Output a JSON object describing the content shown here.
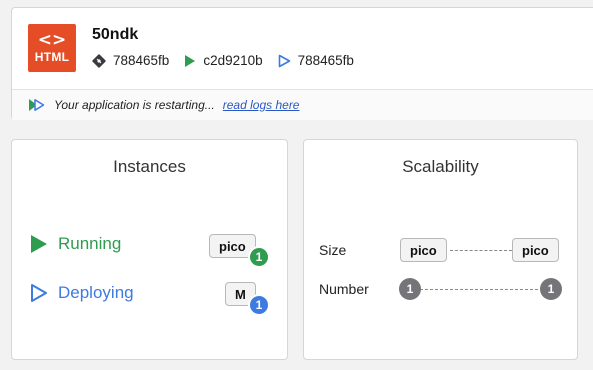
{
  "app": {
    "logo_text": "HTML",
    "logo_glyph": "<>",
    "name": "50ndk",
    "commits": [
      {
        "icon": "git-commit-icon",
        "hash": "788465fb"
      },
      {
        "icon": "running-commit-icon",
        "hash": "c2d9210b"
      },
      {
        "icon": "deploying-commit-icon",
        "hash": "788465fb"
      }
    ],
    "status_text": "Your application is restarting...",
    "logs_link": "read logs here"
  },
  "instances": {
    "title": "Instances",
    "rows": [
      {
        "label": "Running",
        "flavor": "pico",
        "count": "1",
        "color": "#2f9c4f"
      },
      {
        "label": "Deploying",
        "flavor": "M",
        "count": "1",
        "color": "#3d7be0"
      }
    ]
  },
  "scalability": {
    "title": "Scalability",
    "size_label": "Size",
    "size_min": "pico",
    "size_max": "pico",
    "number_label": "Number",
    "number_min": "1",
    "number_max": "1"
  }
}
